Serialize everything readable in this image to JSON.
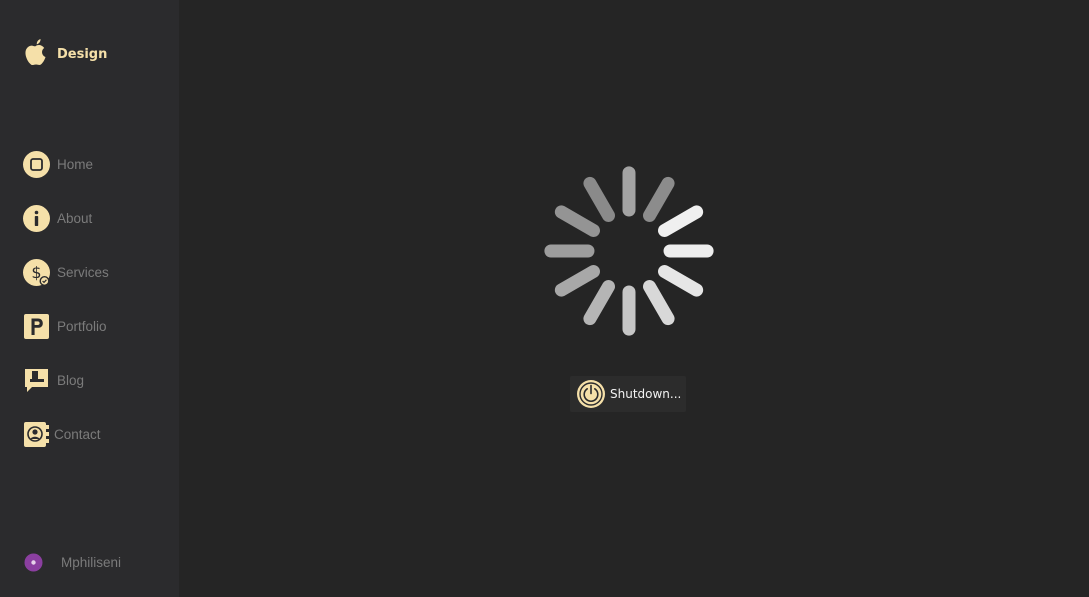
{
  "brand": {
    "label": "Design",
    "icon": "apple-icon"
  },
  "nav": {
    "items": [
      {
        "label": "Home",
        "icon": "home-icon"
      },
      {
        "label": "About",
        "icon": "info-icon"
      },
      {
        "label": "Services",
        "icon": "dollar-icon"
      },
      {
        "label": "Portfolio",
        "icon": "portfolio-icon"
      },
      {
        "label": "Blog",
        "icon": "blog-icon"
      },
      {
        "label": "Contact",
        "icon": "contact-icon"
      }
    ]
  },
  "user": {
    "name": "Mphiliseni",
    "avatar_color": "#8b3fa0"
  },
  "status": {
    "label": "Shutdown...",
    "icon": "power-icon"
  },
  "colors": {
    "accent": "#f5e0a9",
    "sidebar_bg": "#2b2b2d",
    "main_bg": "#252525",
    "muted_text": "#7b7b7b"
  }
}
